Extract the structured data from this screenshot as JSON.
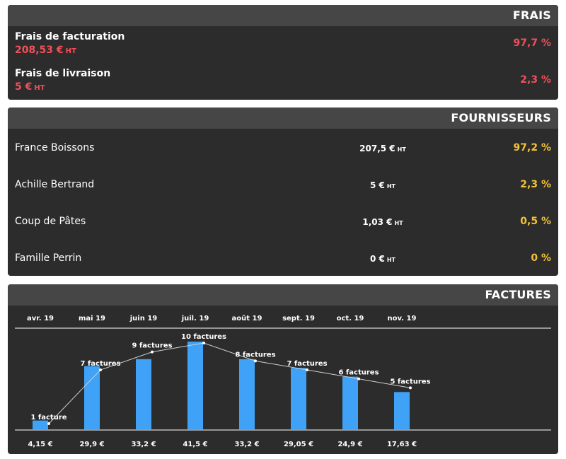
{
  "frais": {
    "title": "FRAIS",
    "items": [
      {
        "label": "Frais de facturation",
        "amount": "208,53 €",
        "unit": "HT",
        "percent": "97,7 %"
      },
      {
        "label": "Frais de livraison",
        "amount": "5 €",
        "unit": "HT",
        "percent": "2,3 %"
      }
    ]
  },
  "fournisseurs": {
    "title": "FOURNISSEURS",
    "items": [
      {
        "name": "France Boissons",
        "amount": "207,5 €",
        "unit": "HT",
        "percent": "97,2 %"
      },
      {
        "name": "Achille Bertrand",
        "amount": "5 €",
        "unit": "HT",
        "percent": "2,3 %"
      },
      {
        "name": "Coup de Pâtes",
        "amount": "1,03 €",
        "unit": "HT",
        "percent": "0,5 %"
      },
      {
        "name": "Famille Perrin",
        "amount": "0 €",
        "unit": "HT",
        "percent": "0 %"
      }
    ]
  },
  "factures": {
    "title": "FACTURES"
  },
  "colors": {
    "card_bg": "#2c2c2c",
    "header_bg": "#464646",
    "red": "#f0505a",
    "yellow": "#f2c233",
    "bar": "#3fa2f7"
  },
  "chart_data": {
    "type": "bar",
    "categories": [
      "avr. 19",
      "mai 19",
      "juin 19",
      "juil. 19",
      "août 19",
      "sept. 19",
      "oct. 19",
      "nov. 19"
    ],
    "values": [
      4.15,
      29.9,
      33.2,
      41.5,
      33.2,
      29.05,
      24.9,
      17.63
    ],
    "value_labels": [
      "4,15 €",
      "29,9 €",
      "33,2 €",
      "41,5 €",
      "33,2 €",
      "29,05 €",
      "24,9 €",
      "17,63 €"
    ],
    "line_series": {
      "values": [
        1,
        7,
        9,
        10,
        8,
        7,
        6,
        5
      ],
      "labels": [
        "1 facture",
        "7 factures",
        "9 factures",
        "10 factures",
        "8 factures",
        "7 factures",
        "6 factures",
        "5 factures"
      ]
    },
    "ylim": [
      0,
      41.5
    ],
    "grid": false
  }
}
